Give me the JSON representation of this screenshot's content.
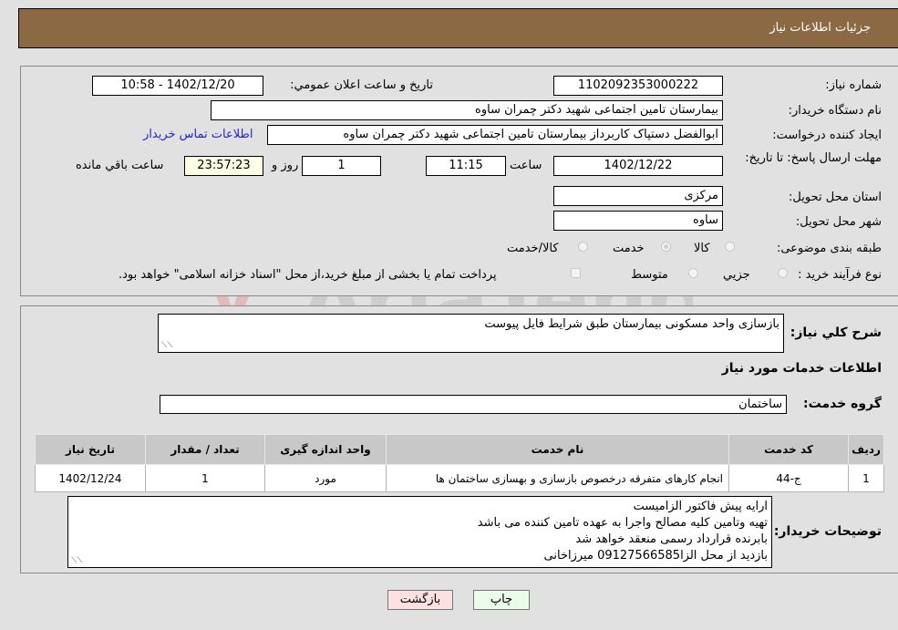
{
  "header": {
    "title": "جزئیات اطلاعات نیاز"
  },
  "form": {
    "need_number": {
      "label": "شماره نیاز:",
      "value": "1102092353000222"
    },
    "announce_datetime": {
      "label": "تاریخ و ساعت اعلان عمومي:",
      "value": "1402/12/20 - 10:58"
    },
    "buyer_org": {
      "label": "نام دستگاه خریدار:",
      "value": "بیمارستان تامین اجتماعی شهید دکتر چمران ساوه"
    },
    "creator": {
      "label": "ایجاد کننده درخواست:",
      "value": "ابوالفضل  دستپاک  کاربرداز بیمارستان تامین اجتماعی شهید دکتر چمران ساوه"
    },
    "contact_link": "اطلاعات تماس خریدار",
    "deadline": {
      "label": "مهلت ارسال پاسخ: تا تاریخ:",
      "date": "1402/12/22",
      "time_label": "ساعت",
      "time": "11:15",
      "days": "1",
      "days_label": "روز و",
      "remaining": "23:57:23",
      "remaining_label": "ساعت باقي مانده"
    },
    "province": {
      "label": "استان محل تحویل:",
      "value": "مرکزی"
    },
    "city": {
      "label": "شهر محل تحویل:",
      "value": "ساوه"
    },
    "category": {
      "label": "طبقه بندی موضوعی:",
      "options": [
        "کالا",
        "خدمت",
        "کالا/خدمت"
      ],
      "selected": "خدمت"
    },
    "process": {
      "label": "نوع فرآیند خرید :",
      "options": [
        "جزيي",
        "متوسط"
      ],
      "selected": "جزيي",
      "treasury_note": "پرداخت تمام یا بخشی از مبلغ خرید،از محل \"اسناد خزانه اسلامی\" خواهد بود."
    }
  },
  "details": {
    "summary_label": "شرح کلي نیاز:",
    "summary_value": "بازسازی واحد مسکونی بیمارستان طبق شرایط فایل پیوست",
    "services_title": "اطلاعات خدمات مورد نیاز",
    "service_group_label": "گروه خدمت:",
    "service_group_value": "ساختمان",
    "table": {
      "headers": [
        "ردیف",
        "کد خدمت",
        "نام خدمت",
        "واحد اندازه گیری",
        "تعداد / مقدار",
        "تاریخ نیاز"
      ],
      "rows": [
        [
          "1",
          "ج-44",
          "انجام کارهای متفرقه درخصوص بازسازی و بهسازی ساختمان ها",
          "مورد",
          "1",
          "1402/12/24"
        ]
      ]
    },
    "buyer_notes_label": "توضیحات خریدار:",
    "buyer_notes": [
      "ارایه پیش فاکتور الزامیست",
      "تهیه وتامین کلیه مصالح واجرا به عهده تامین کننده می باشد",
      "بابرنده قرارداد رسمی منعقد خواهد شد",
      "بازدید از محل الزا09127566585 میرزاخانی"
    ]
  },
  "buttons": {
    "print": "چاپ",
    "back": "بازگشت"
  },
  "colors": {
    "header_bg": "#8b6a43",
    "print_bg": "#e9fde9",
    "back_bg": "#fde0e0",
    "link": "#2323d6"
  }
}
